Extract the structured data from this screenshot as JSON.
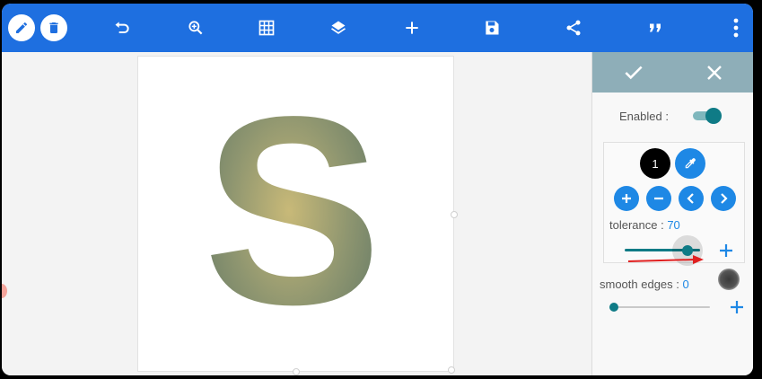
{
  "toolbar": {
    "icons": [
      "pencil-icon",
      "trash-icon",
      "undo-icon",
      "zoom-in-icon",
      "grid-icon",
      "layers-icon",
      "add-icon",
      "save-icon",
      "share-icon",
      "quote-icon",
      "more-vert-icon"
    ]
  },
  "canvas": {
    "letter": "S"
  },
  "panel": {
    "header_icons": [
      "check-icon",
      "close-icon"
    ],
    "enabled_label": "Enabled :",
    "enabled": true,
    "color_index": "1",
    "tolerance_label": "tolerance : ",
    "tolerance_value": "70",
    "tolerance_fraction": 0.83,
    "smooth_label": "smooth edges : ",
    "smooth_value": "0",
    "smooth_fraction": 0.0
  },
  "colors": {
    "toolbar": "#1e6fe0",
    "panel_header": "#8eaeb8",
    "accent": "#1e88e5",
    "toggle": "#0f7b86",
    "letter_center": "#c8b978",
    "letter_edge": "#6e8068",
    "arrow": "#e02020"
  }
}
